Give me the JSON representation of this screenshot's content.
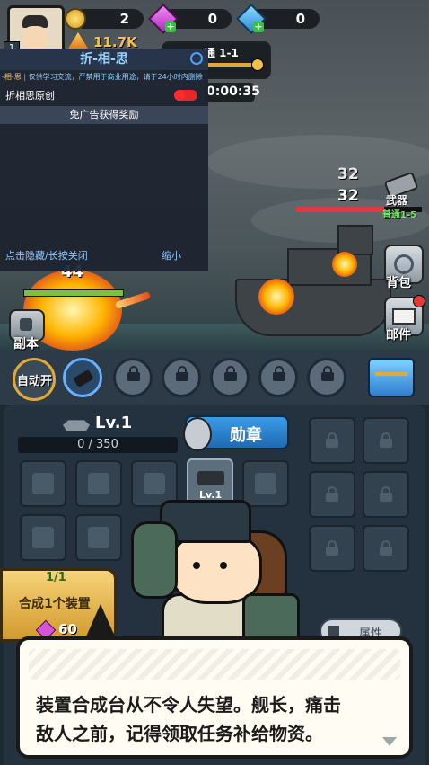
{
  "currency": {
    "coins": "2",
    "gems": "0",
    "crystals": "0",
    "power": "11.7K"
  },
  "stage": {
    "label": "通 1-1",
    "timer": "0:00:35"
  },
  "overlay": {
    "title": "折-相-思",
    "notice_prefix": "-相-思",
    "notice": "仅供学习交流，严禁用于商业用途，请于24小时内删除",
    "original_label": "折相思原创",
    "ad_reward": "免广告获得奖励",
    "hide_hint": "点击隐藏/长按关闭",
    "minimize": "缩小"
  },
  "enemy": {
    "hp_top": "32",
    "hp_bottom": "32",
    "weapon_label": "武器",
    "weapon_stage": "普通1-5"
  },
  "player": {
    "damage": "44"
  },
  "side": {
    "bag": "背包",
    "mail": "邮件",
    "dungeon": "副本"
  },
  "skillbar": {
    "auto": "自动开"
  },
  "panel": {
    "level": "Lv.1",
    "exp": "0 / 350",
    "medal": "勋章",
    "weapon_level": "Lv.1",
    "synth_count": "1/1",
    "synth_label": "合成1个装置",
    "synth_cost": "60",
    "attr": "属性"
  },
  "dialog": {
    "line1": "装置合成台从不令人失望。舰长，痛击",
    "line2": "敌人之前，记得领取任务补给物资。"
  },
  "colors": {
    "accent_blue": "#2f7fd1",
    "gold": "#e0a93a",
    "red": "#e23a3a"
  }
}
